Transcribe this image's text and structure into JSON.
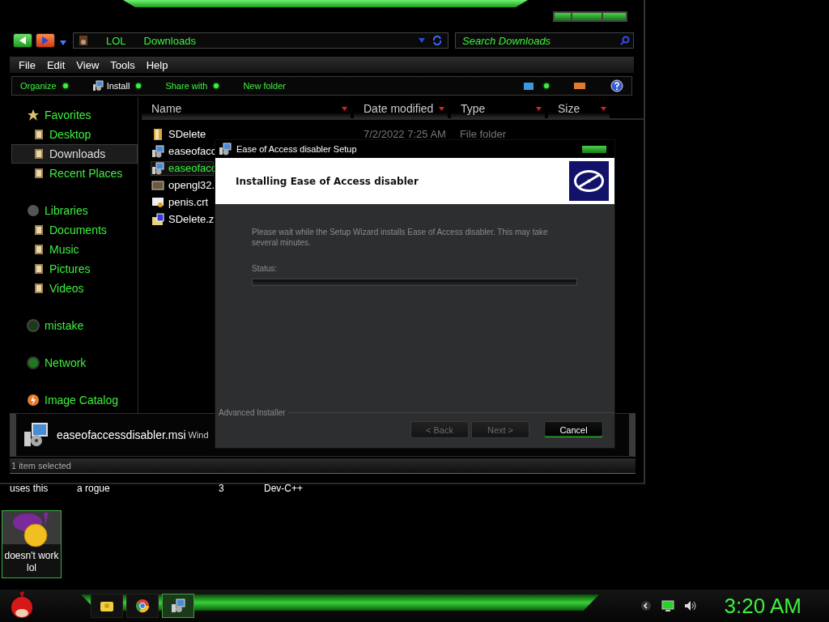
{
  "explorer": {
    "address": {
      "segments": [
        "LOL",
        "Downloads"
      ]
    },
    "search": {
      "placeholder": "Search Downloads"
    },
    "menu": [
      "File",
      "Edit",
      "View",
      "Tools",
      "Help"
    ],
    "commands": [
      {
        "label": "Organize",
        "kind": "dropdown"
      },
      {
        "label": "Install",
        "kind": "install"
      },
      {
        "label": "Share with",
        "kind": "dropdown"
      },
      {
        "label": "New folder",
        "kind": "plain"
      }
    ],
    "nav": [
      {
        "label": "Favorites",
        "kind": "star",
        "children": [
          {
            "label": "Desktop",
            "selected": false
          },
          {
            "label": "Downloads",
            "selected": true
          },
          {
            "label": "Recent Places",
            "selected": false
          }
        ]
      },
      {
        "label": "Libraries",
        "kind": "library",
        "children": [
          {
            "label": "Documents",
            "selected": false
          },
          {
            "label": "Music",
            "selected": false
          },
          {
            "label": "Pictures",
            "selected": false
          },
          {
            "label": "Videos",
            "selected": false
          }
        ]
      },
      {
        "label": "mistake",
        "kind": "homegroup"
      },
      {
        "label": "Network",
        "kind": "network"
      },
      {
        "label": "Image Catalog",
        "kind": "catalog"
      }
    ],
    "columns": [
      "Name",
      "Date modified",
      "Type",
      "Size"
    ],
    "files": [
      {
        "name": "SDelete",
        "date": "7/2/2022 7:25 AM",
        "type": "File folder",
        "kind": "folder",
        "selected": false
      },
      {
        "name": "easeofacc",
        "kind": "installer",
        "selected": false
      },
      {
        "name": "easeofacc",
        "kind": "installer",
        "selected": true
      },
      {
        "name": "opengl32.",
        "kind": "file",
        "selected": false
      },
      {
        "name": "penis.crt",
        "kind": "certificate",
        "selected": false
      },
      {
        "name": "SDelete.z",
        "kind": "archive",
        "selected": false
      }
    ],
    "details": {
      "name": "easeofaccessdisabler.msi",
      "type": "Wind"
    },
    "status": "1 item selected"
  },
  "setup": {
    "title": "Ease of Access disabler Setup",
    "heading": "Installing Ease of Access disabler",
    "message": "Please wait while the Setup Wizard installs Ease of Access disabler.  This may take several minutes.",
    "status_label": "Status:",
    "level": 0,
    "brand": "Advanced Installer",
    "buttons": [
      {
        "label": "< Back",
        "disabled": true
      },
      {
        "label": "Next >",
        "disabled": true
      },
      {
        "label": "Cancel",
        "disabled": false
      }
    ]
  },
  "desktop": {
    "texts": [
      "uses this",
      "a rogue",
      "3",
      "Dev-C++"
    ],
    "icon": {
      "label": "doesn't work lol",
      "selected": true
    }
  },
  "taskbar": {
    "apps": [
      {
        "kind": "folder",
        "active": false
      },
      {
        "kind": "browser",
        "active": false
      },
      {
        "kind": "installer",
        "active": true
      }
    ],
    "clock": "3:20 AM"
  }
}
